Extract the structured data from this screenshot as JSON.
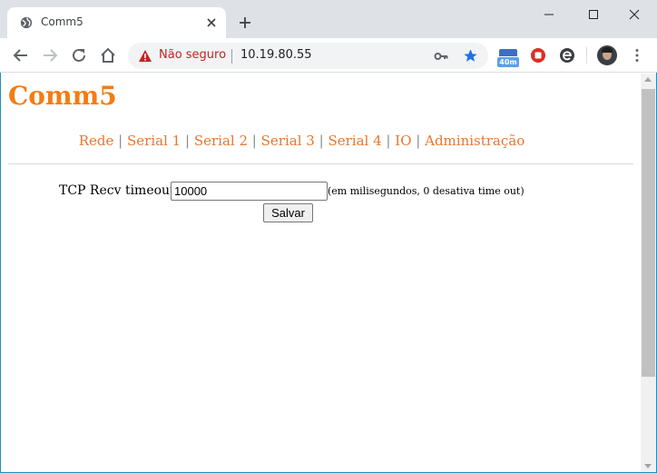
{
  "browser": {
    "tab_title": "Comm5",
    "security_label": "Não seguro",
    "url": "10.19.80.55",
    "extension_badge": "40m",
    "colors": {
      "tabstrip": "#dee1e6",
      "warning": "#c5221f",
      "star": "#1a73e8"
    }
  },
  "page": {
    "site_title": "Comm5",
    "nav": [
      {
        "label": "Rede"
      },
      {
        "label": "Serial 1"
      },
      {
        "label": "Serial 2"
      },
      {
        "label": "Serial 3"
      },
      {
        "label": "Serial 4"
      },
      {
        "label": "IO"
      },
      {
        "label": "Administração"
      }
    ],
    "nav_separator": "|",
    "form": {
      "label": "TCP Recv timeout",
      "value": "10000",
      "hint": "(em milisegundos, 0 desativa time out)",
      "save_label": "Salvar"
    },
    "colors": {
      "title": "#f47c12",
      "links": "#e8762d"
    }
  }
}
